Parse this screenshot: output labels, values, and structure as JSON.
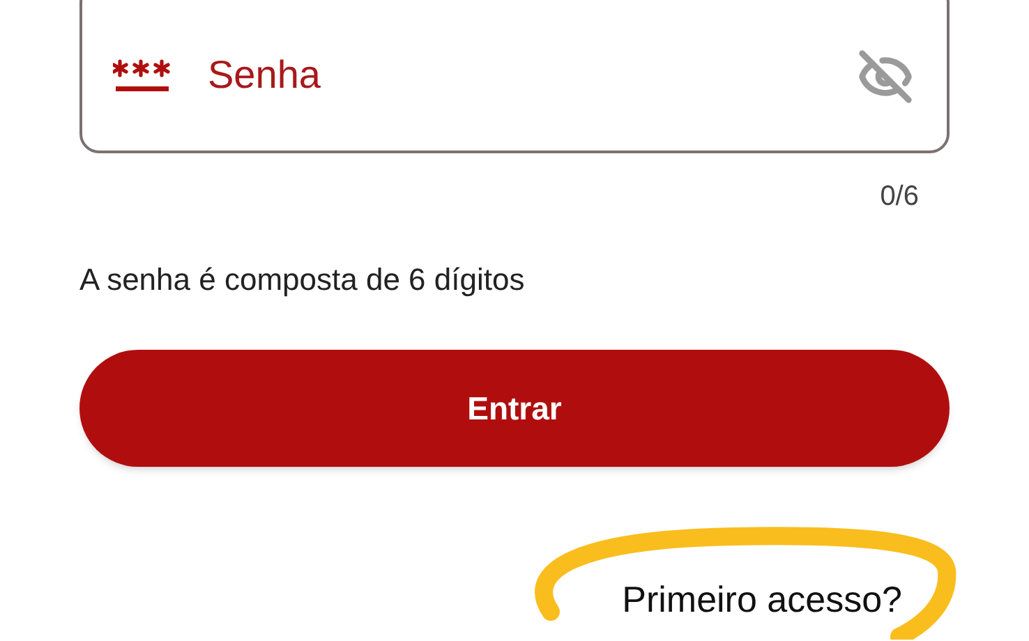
{
  "password_field": {
    "label": "Senha",
    "counter": "0/6"
  },
  "helper_text": "A senha é composta de 6 dígitos",
  "login_button": {
    "label": "Entrar"
  },
  "first_access_link": {
    "label": "Primeiro acesso?"
  }
}
